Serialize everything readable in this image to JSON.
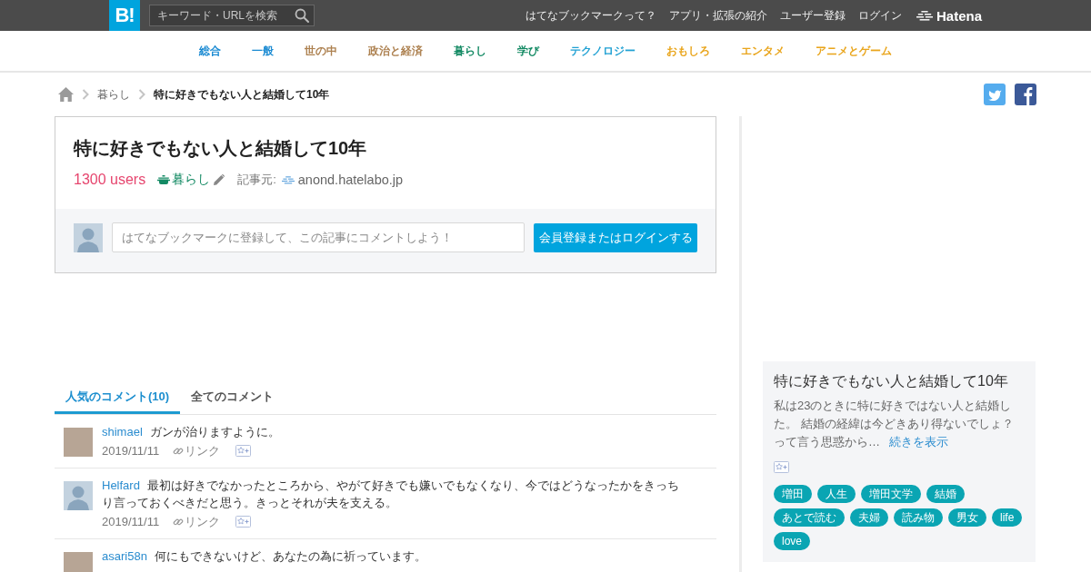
{
  "topbar": {
    "logo": "B!",
    "search": {
      "placeholder": "キーワード・URLを検索"
    },
    "links": [
      "はてなブックマークって？",
      "アプリ・拡張の紹介",
      "ユーザー登録",
      "ログイン"
    ],
    "brand": "Hatena"
  },
  "categories": [
    {
      "label": "総合",
      "color": "#1a8ad2"
    },
    {
      "label": "一般",
      "color": "#1a8ad2"
    },
    {
      "label": "世の中",
      "color": "#ad8150"
    },
    {
      "label": "政治と経済",
      "color": "#ad8150"
    },
    {
      "label": "暮らし",
      "color": "#148a64"
    },
    {
      "label": "学び",
      "color": "#148a64"
    },
    {
      "label": "テクノロジー",
      "color": "#21a1d3"
    },
    {
      "label": "おもしろ",
      "color": "#e9a51c"
    },
    {
      "label": "エンタメ",
      "color": "#e9a51c"
    },
    {
      "label": "アニメとゲーム",
      "color": "#e9a51c"
    }
  ],
  "breadcrumb": [
    {
      "label": "暮らし",
      "current": false
    },
    {
      "label": "特に好きでもない人と結婚して10年",
      "current": true
    }
  ],
  "entry": {
    "title": "特に好きでもない人と結婚して10年",
    "users": "1300 users",
    "category": "暮らし",
    "source_label": "記事元:",
    "source": "anond.hatelabo.jp",
    "comment_form": {
      "placeholder": "はてなブックマークに登録して、この記事にコメントしよう！",
      "button": "会員登録またはログインする"
    }
  },
  "comment_tabs": [
    {
      "label": "人気のコメント(10)",
      "selected": true
    },
    {
      "label": "全てのコメント",
      "selected": false
    }
  ],
  "comments": [
    {
      "avatar": {
        "kind": "photo"
      },
      "user": "shimael",
      "text": "ガンが治りますように。",
      "date": "2019/11/11",
      "link": "リンク"
    },
    {
      "avatar": {
        "kind": "silhouette"
      },
      "user": "Helfard",
      "text": "最初は好きでなかったところから、やがて好きでも嫌いでもなくなり、今ではどうなったかをきっちり言っておくべきだと思う。きっとそれが夫を支える。",
      "date": "2019/11/11",
      "link": "リンク"
    },
    {
      "avatar": {
        "kind": "photo"
      },
      "user": "asari58n",
      "text": "何にもできないけど、あなたの為に祈っています。"
    }
  ],
  "related": {
    "title": "特に好きでもない人と結婚して10年",
    "summary": "私は23のときに特に好きではない人と結婚した。 結婚の経緯は今どきあり得ないでしょ？って言う思惑から…",
    "more": "続きを表示",
    "tags": [
      "増田",
      "人生",
      "増田文学",
      "結婚",
      "あとで読む",
      "夫婦",
      "読み物",
      "男女",
      "life",
      "love"
    ]
  }
}
